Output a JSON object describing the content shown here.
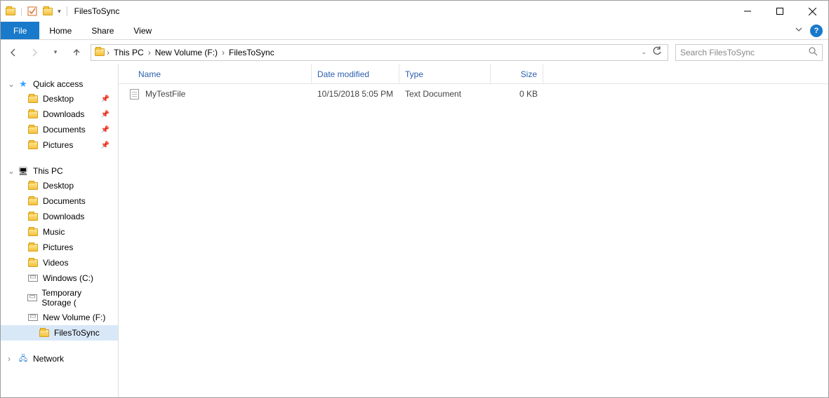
{
  "window": {
    "title": "FilesToSync"
  },
  "ribbon": {
    "file": "File",
    "tabs": [
      "Home",
      "Share",
      "View"
    ]
  },
  "breadcrumb": {
    "segments": [
      "This PC",
      "New Volume (F:)",
      "FilesToSync"
    ]
  },
  "search": {
    "placeholder": "Search FilesToSync"
  },
  "columns": {
    "name": "Name",
    "date": "Date modified",
    "type": "Type",
    "size": "Size"
  },
  "files": [
    {
      "name": "MyTestFile",
      "date": "10/15/2018 5:05 PM",
      "type": "Text Document",
      "size": "0 KB"
    }
  ],
  "sidebar": {
    "quick_access": {
      "label": "Quick access",
      "items": [
        {
          "label": "Desktop",
          "pinned": true
        },
        {
          "label": "Downloads",
          "pinned": true
        },
        {
          "label": "Documents",
          "pinned": true
        },
        {
          "label": "Pictures",
          "pinned": true
        }
      ]
    },
    "this_pc": {
      "label": "This PC",
      "items": [
        {
          "label": "Desktop"
        },
        {
          "label": "Documents"
        },
        {
          "label": "Downloads"
        },
        {
          "label": "Music"
        },
        {
          "label": "Pictures"
        },
        {
          "label": "Videos"
        },
        {
          "label": "Windows (C:)"
        },
        {
          "label": "Temporary Storage ("
        },
        {
          "label": "New Volume (F:)",
          "children": [
            {
              "label": "FilesToSync",
              "selected": true
            }
          ]
        }
      ]
    },
    "network": {
      "label": "Network"
    }
  }
}
